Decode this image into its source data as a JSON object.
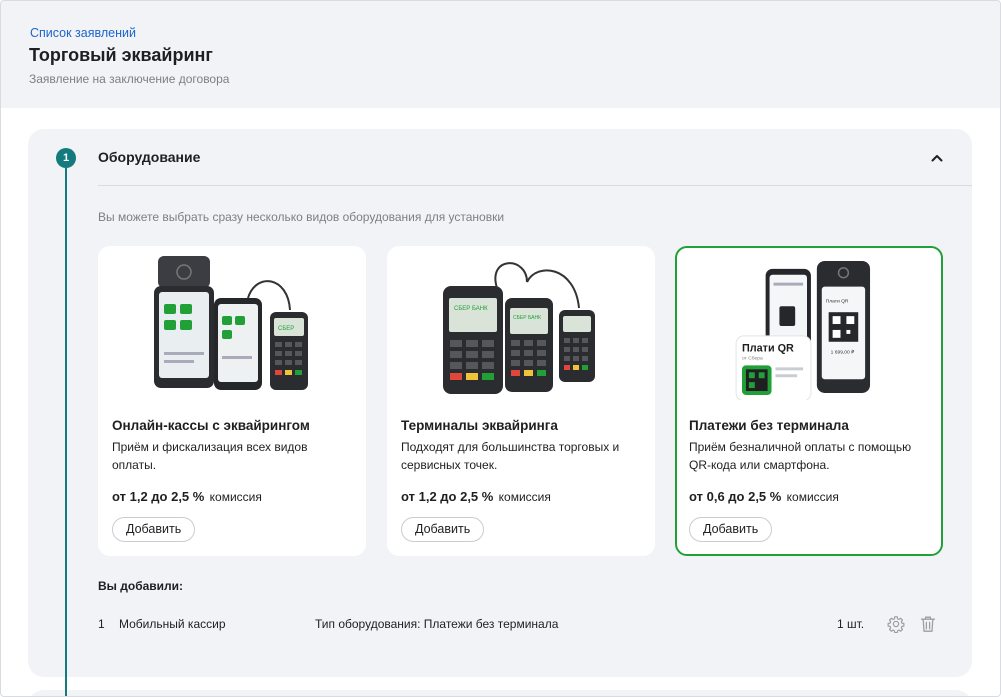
{
  "header": {
    "breadcrumb": "Список заявлений",
    "title": "Торговый эквайринг",
    "subtitle": "Заявление на заключение договора"
  },
  "section": {
    "step": "1",
    "title": "Оборудование",
    "hint": "Вы можете выбрать сразу несколько видов оборудования для установки"
  },
  "cards": [
    {
      "title": "Онлайн-кассы с эквайрингом",
      "desc": "Приём и фискализация всех видов оплаты.",
      "rate": "от 1,2 до 2,5 %",
      "fee": "комиссия",
      "button": "Добавить"
    },
    {
      "title": "Терминалы эквайринга",
      "desc": "Подходят для большинства торговых и сервисных точек.",
      "rate": "от 1,2 до 2,5 %",
      "fee": "комиссия",
      "button": "Добавить"
    },
    {
      "title": "Платежи без терминала",
      "desc": "Приём безналичной оплаты с помощью QR-кода или смартфона.",
      "rate": "от 0,6 до 2,5 %",
      "fee": "комиссия",
      "button": "Добавить",
      "qr_badge": "Плати QR",
      "qr_badge_sub": "от Сбера"
    }
  ],
  "added": {
    "title": "Вы добавили:",
    "items": [
      {
        "num": "1",
        "name": "Мобильный кассир",
        "type": "Тип оборудования: Платежи без терминала",
        "qty": "1 шт."
      }
    ]
  },
  "colors": {
    "accent_teal": "#137b7e",
    "selected_border": "#21a038",
    "link": "#1a66c9"
  },
  "icons": {
    "collapse": "chevron-up-icon",
    "settings": "gear-icon",
    "delete": "trash-icon"
  }
}
